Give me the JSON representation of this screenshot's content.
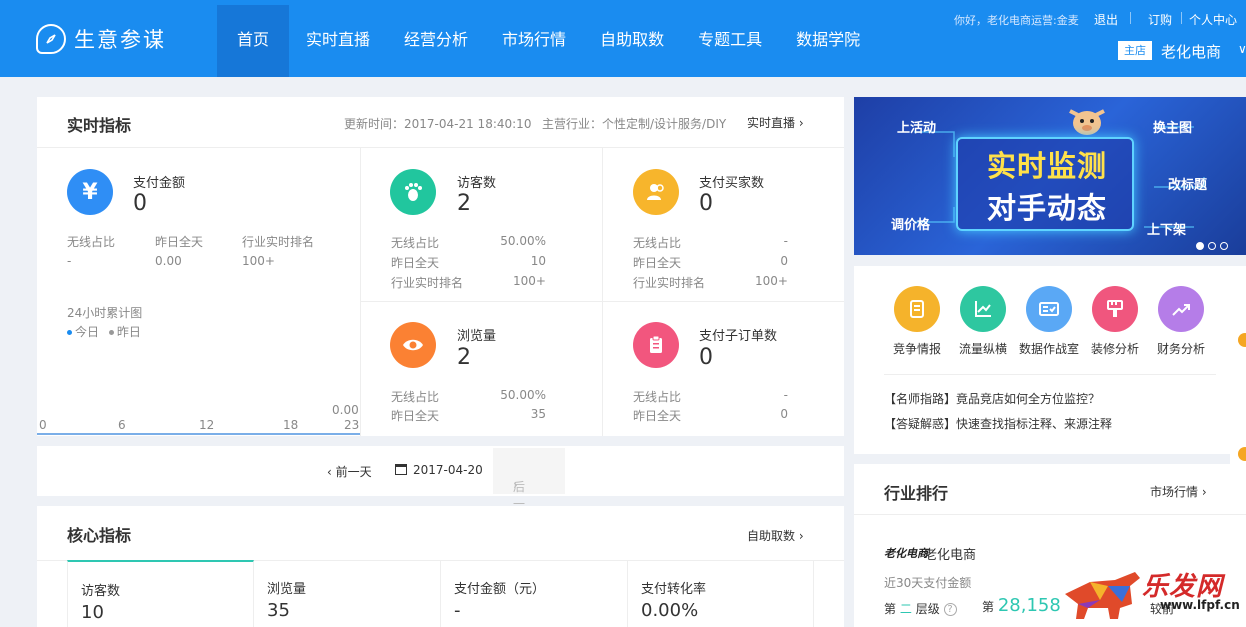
{
  "header": {
    "app_name": "生意参谋",
    "nav": [
      "首页",
      "实时直播",
      "经营分析",
      "市场行情",
      "自助取数",
      "专题工具",
      "数据学院"
    ],
    "greeting": "你好，老化电商运营:金麦",
    "logout": "退出",
    "subscribe": "订购",
    "profile": "个人中心",
    "shop_tag": "主店",
    "shop_name": "老化电商",
    "shop_caret": "∨"
  },
  "realtime": {
    "title": "实时指标",
    "update_time": "更新时间：2017-04-21 18:40:10",
    "industry": "主营行业：个性定制/设计服务/DIY",
    "live_link": "实时直播",
    "pay": {
      "name": "支付金额",
      "value": "0",
      "labels": [
        "无线占比",
        "昨日全天",
        "行业实时排名"
      ],
      "values": [
        "-",
        "0.00",
        "100+"
      ]
    },
    "visitors": {
      "name": "访客数",
      "value": "2",
      "labels": [
        "无线占比",
        "昨日全天",
        "行业实时排名"
      ],
      "values": [
        "50.00%",
        "10",
        "100+"
      ]
    },
    "buyers": {
      "name": "支付买家数",
      "value": "0",
      "labels": [
        "无线占比",
        "昨日全天",
        "行业实时排名"
      ],
      "values": [
        "-",
        "0",
        "100+"
      ]
    },
    "pageviews": {
      "name": "浏览量",
      "value": "2",
      "labels": [
        "无线占比",
        "昨日全天"
      ],
      "values": [
        "50.00%",
        "35"
      ]
    },
    "suborders": {
      "name": "支付子订单数",
      "value": "0",
      "labels": [
        "无线占比",
        "昨日全天"
      ],
      "values": [
        "-",
        "0"
      ]
    },
    "chart": {
      "title": "24小时累计图",
      "legend_today": "今日",
      "legend_yesterday": "昨日",
      "today_color": "#1a8cf0",
      "yesterday_color": "#999999",
      "y_top": "0.00",
      "x_ticks": [
        "0",
        "6",
        "12",
        "18",
        "23"
      ]
    }
  },
  "datebar": {
    "prev": "前一天",
    "date": "2017-04-20",
    "next": "后一天"
  },
  "core": {
    "title": "核心指标",
    "link": "自助取数",
    "tabs": [
      {
        "name": "访客数",
        "value": "10"
      },
      {
        "name": "浏览量",
        "value": "35"
      },
      {
        "name": "支付金额（元）",
        "value": "-"
      },
      {
        "name": "支付转化率",
        "value": "0.00%"
      }
    ]
  },
  "banner": {
    "line1": "实时监测",
    "line2": "对手动态",
    "tags": [
      "上活动",
      "换主图",
      "改标题",
      "调价格",
      "上下架"
    ]
  },
  "tools": {
    "items": [
      {
        "label": "竞争情报",
        "color": "#f5b32b",
        "icon": "document-icon"
      },
      {
        "label": "流量纵横",
        "color": "#2ec7a0",
        "icon": "line-chart-icon"
      },
      {
        "label": "数据作战室",
        "color": "#5aa8f5",
        "icon": "id-card-icon"
      },
      {
        "label": "装修分析",
        "color": "#f0567e",
        "icon": "brush-icon"
      },
      {
        "label": "财务分析",
        "color": "#b57de8",
        "icon": "trend-icon"
      }
    ],
    "tips": [
      "【名师指路】竟品竞店如何全方位监控？",
      "【答疑解惑】快速查找指标注释、来源注释"
    ]
  },
  "rank": {
    "title": "行业排行",
    "link": "市场行情",
    "logo": "老化电商",
    "shop": "老化电商",
    "sub": "近30天支付金额",
    "rank_prefix": "第",
    "rank_level": "二",
    "rank_level_suffix": "层级",
    "rank_number": "28,158",
    "cut_label": "较前",
    "help": "?"
  },
  "watermark": {
    "text": "乐发网",
    "url": "www.lfpf.cn"
  }
}
